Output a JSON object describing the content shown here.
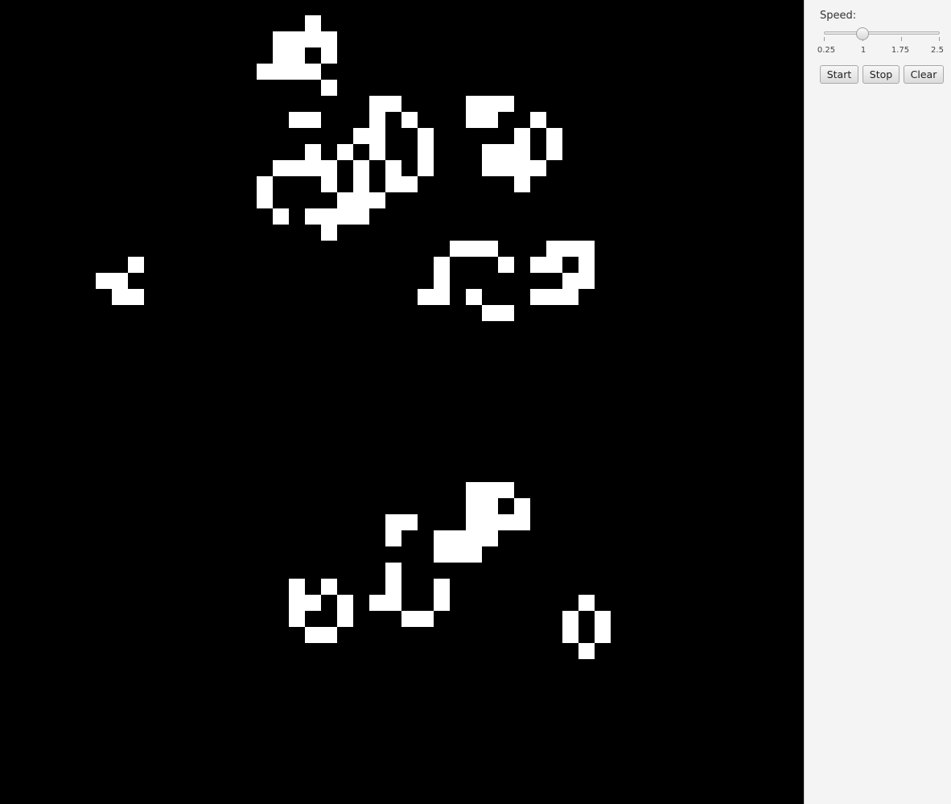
{
  "board": {
    "background": "#000000",
    "cell_color": "#ffffff",
    "live_cells": [
      [
        19,
        1
      ],
      [
        17,
        2
      ],
      [
        18,
        2
      ],
      [
        19,
        2
      ],
      [
        20,
        2
      ],
      [
        17,
        3
      ],
      [
        18,
        3
      ],
      [
        20,
        3
      ],
      [
        16,
        4
      ],
      [
        17,
        4
      ],
      [
        18,
        4
      ],
      [
        19,
        4
      ],
      [
        20,
        5
      ],
      [
        23,
        6
      ],
      [
        24,
        6
      ],
      [
        29,
        6
      ],
      [
        30,
        6
      ],
      [
        31,
        6
      ],
      [
        18,
        7
      ],
      [
        19,
        7
      ],
      [
        23,
        7
      ],
      [
        25,
        7
      ],
      [
        29,
        7
      ],
      [
        30,
        7
      ],
      [
        33,
        7
      ],
      [
        22,
        8
      ],
      [
        23,
        8
      ],
      [
        26,
        8
      ],
      [
        32,
        8
      ],
      [
        34,
        8
      ],
      [
        19,
        9
      ],
      [
        21,
        9
      ],
      [
        23,
        9
      ],
      [
        26,
        9
      ],
      [
        30,
        9
      ],
      [
        31,
        9
      ],
      [
        32,
        9
      ],
      [
        34,
        9
      ],
      [
        17,
        10
      ],
      [
        18,
        10
      ],
      [
        19,
        10
      ],
      [
        20,
        10
      ],
      [
        22,
        10
      ],
      [
        24,
        10
      ],
      [
        26,
        10
      ],
      [
        30,
        10
      ],
      [
        31,
        10
      ],
      [
        32,
        10
      ],
      [
        33,
        10
      ],
      [
        16,
        11
      ],
      [
        20,
        11
      ],
      [
        22,
        11
      ],
      [
        24,
        11
      ],
      [
        25,
        11
      ],
      [
        32,
        11
      ],
      [
        16,
        12
      ],
      [
        21,
        12
      ],
      [
        22,
        12
      ],
      [
        23,
        12
      ],
      [
        17,
        13
      ],
      [
        19,
        13
      ],
      [
        20,
        13
      ],
      [
        21,
        13
      ],
      [
        22,
        13
      ],
      [
        20,
        14
      ],
      [
        28,
        15
      ],
      [
        29,
        15
      ],
      [
        30,
        15
      ],
      [
        34,
        15
      ],
      [
        35,
        15
      ],
      [
        36,
        15
      ],
      [
        8,
        16
      ],
      [
        27,
        16
      ],
      [
        31,
        16
      ],
      [
        33,
        16
      ],
      [
        34,
        16
      ],
      [
        36,
        16
      ],
      [
        27,
        17
      ],
      [
        35,
        17
      ],
      [
        36,
        17
      ],
      [
        6,
        17
      ],
      [
        7,
        17
      ],
      [
        7,
        18
      ],
      [
        8,
        18
      ],
      [
        26,
        18
      ],
      [
        27,
        18
      ],
      [
        29,
        18
      ],
      [
        33,
        18
      ],
      [
        34,
        18
      ],
      [
        35,
        18
      ],
      [
        30,
        19
      ],
      [
        31,
        19
      ],
      [
        29,
        30
      ],
      [
        30,
        30
      ],
      [
        31,
        30
      ],
      [
        29,
        31
      ],
      [
        30,
        31
      ],
      [
        32,
        31
      ],
      [
        24,
        32
      ],
      [
        25,
        32
      ],
      [
        29,
        32
      ],
      [
        30,
        32
      ],
      [
        31,
        32
      ],
      [
        32,
        32
      ],
      [
        24,
        33
      ],
      [
        27,
        33
      ],
      [
        28,
        33
      ],
      [
        29,
        33
      ],
      [
        30,
        33
      ],
      [
        27,
        34
      ],
      [
        28,
        34
      ],
      [
        29,
        34
      ],
      [
        24,
        35
      ],
      [
        18,
        36
      ],
      [
        20,
        36
      ],
      [
        24,
        36
      ],
      [
        27,
        36
      ],
      [
        18,
        37
      ],
      [
        19,
        37
      ],
      [
        21,
        37
      ],
      [
        23,
        37
      ],
      [
        24,
        37
      ],
      [
        27,
        37
      ],
      [
        36,
        37
      ],
      [
        18,
        38
      ],
      [
        21,
        38
      ],
      [
        25,
        38
      ],
      [
        26,
        38
      ],
      [
        35,
        38
      ],
      [
        37,
        38
      ],
      [
        19,
        39
      ],
      [
        20,
        39
      ],
      [
        35,
        39
      ],
      [
        37,
        39
      ],
      [
        36,
        40
      ]
    ]
  },
  "controls": {
    "speed_label": "Speed:",
    "speed": {
      "min": 0.25,
      "max": 2.5,
      "value": 1,
      "ticks": [
        "0.25",
        "1",
        "1.75",
        "2.5"
      ]
    },
    "start_label": "Start",
    "stop_label": "Stop",
    "clear_label": "Clear"
  }
}
